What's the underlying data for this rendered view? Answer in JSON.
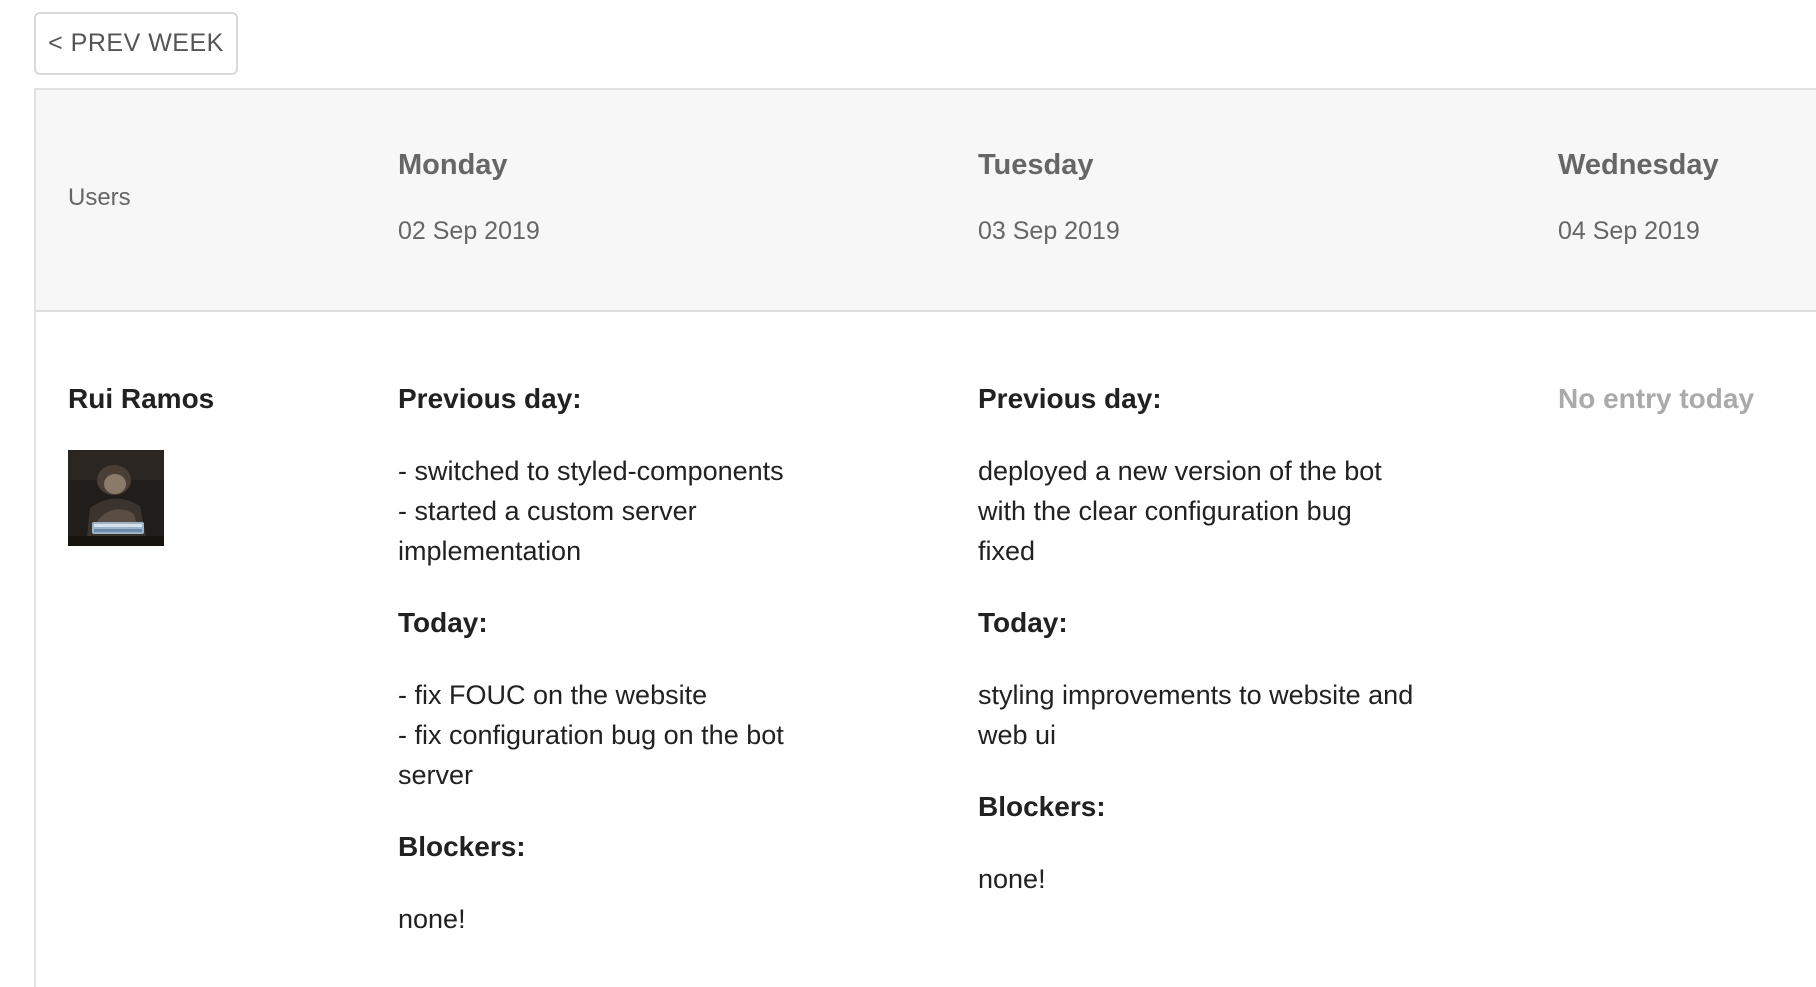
{
  "toolbar": {
    "prev_week_label": "< PREV WEEK"
  },
  "table": {
    "users_header": "Users",
    "days": [
      {
        "name": "Monday",
        "date": "02 Sep 2019"
      },
      {
        "name": "Tuesday",
        "date": "03 Sep 2019"
      },
      {
        "name": "Wednesday",
        "date": "04 Sep 2019"
      }
    ],
    "rows": [
      {
        "user_name": "Rui Ramos",
        "entries": [
          {
            "previous_label": "Previous day:",
            "previous_text": "- switched to styled-components\n- started a custom server\nimplementation",
            "today_label": "Today:",
            "today_text": "- fix FOUC on the website\n- fix configuration bug on the bot\nserver",
            "blockers_label": "Blockers:",
            "blockers_text": "none!"
          },
          {
            "previous_label": "Previous day:",
            "previous_text": "deployed a new version of the bot\nwith the clear configuration bug\nfixed",
            "today_label": "Today:",
            "today_text": "styling improvements to website and\nweb ui",
            "blockers_label": "Blockers:",
            "blockers_text": "none!"
          },
          {
            "no_entry": "No entry today"
          }
        ]
      }
    ]
  },
  "colors": {
    "header_bg": "#f7f7f7",
    "border": "#e2e2e2",
    "muted_text": "#666666",
    "no_entry_text": "#aaaaaa",
    "body_text": "#212121"
  }
}
